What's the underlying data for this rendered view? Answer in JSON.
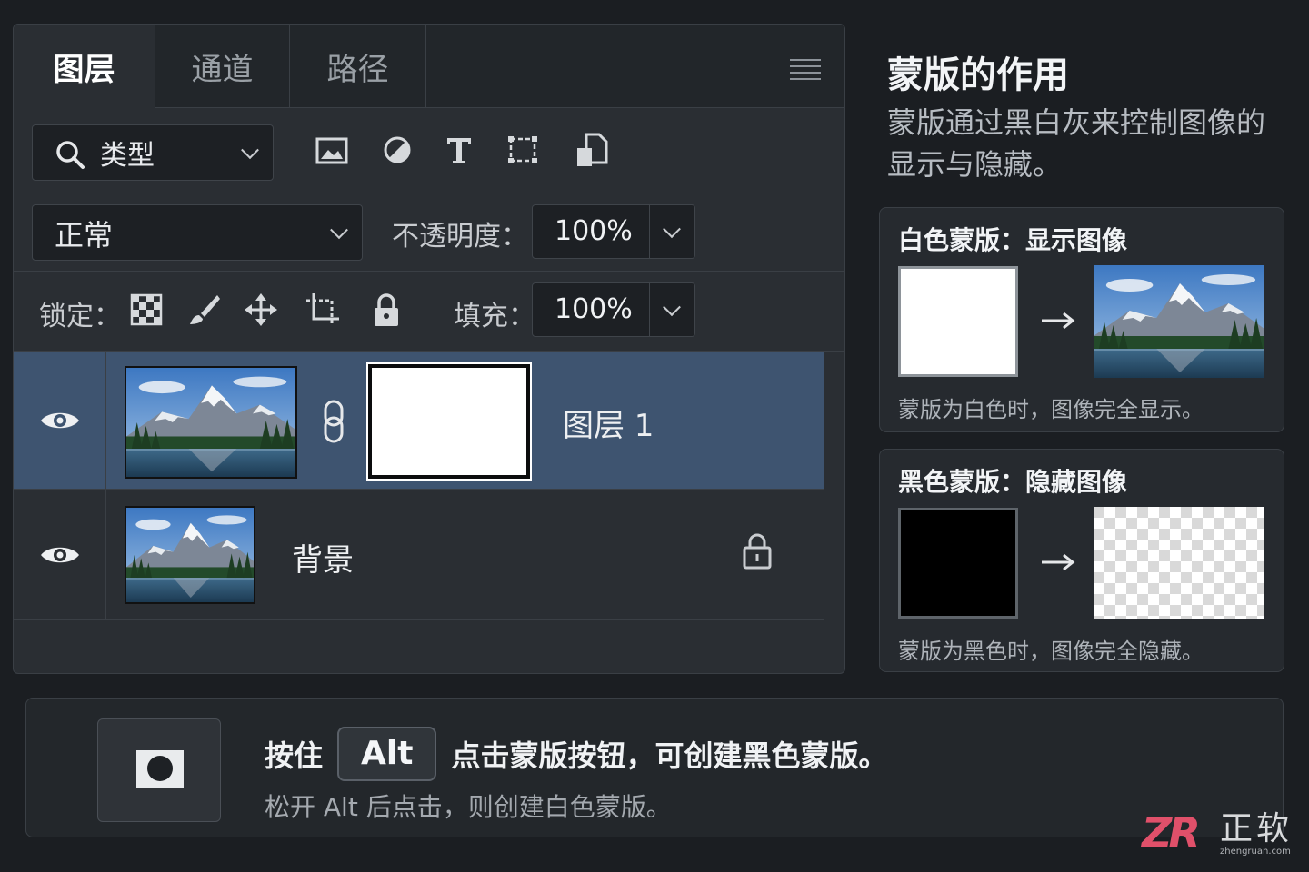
{
  "tabs": [
    {
      "label": "图层",
      "active": true
    },
    {
      "label": "通道",
      "active": false
    },
    {
      "label": "路径",
      "active": false
    }
  ],
  "filter": {
    "label": "类型",
    "icons": [
      "image-filter-icon",
      "adjustment-filter-icon",
      "type-filter-icon",
      "shape-filter-icon",
      "smart-object-filter-icon"
    ]
  },
  "blend": {
    "mode": "正常",
    "opacity_label": "不透明度：",
    "opacity": "100%"
  },
  "lock": {
    "label": "锁定：",
    "fill_label": "填充：",
    "fill": "100%"
  },
  "layers": [
    {
      "name": "图层 1",
      "selected": true,
      "has_mask": true,
      "mask_color": "#ffffff"
    },
    {
      "name": "背景",
      "selected": false,
      "locked": true
    }
  ],
  "info": {
    "title": "蒙版的作用",
    "desc": "蒙版通过黑白灰来控制图像的显示与隐藏。",
    "white_card": {
      "title": "白色蒙版：显示图像",
      "caption": "蒙版为白色时，图像完全显示。"
    },
    "black_card": {
      "title": "黑色蒙版：隐藏图像",
      "caption": "蒙版为黑色时，图像完全隐藏。"
    }
  },
  "tip": {
    "prefix": "按住",
    "key": "Alt",
    "suffix": "点击蒙版按钮，可创建黑色蒙版。",
    "line2": "松开 Alt 后点击，则创建白色蒙版。"
  },
  "watermark": {
    "logo": "ZR",
    "cn": "正软",
    "en": "zhengruan.com"
  },
  "colors": {
    "selected_row": "#3e5470",
    "panel_bg": "#2a2e33",
    "page_bg": "#1b1e22"
  }
}
